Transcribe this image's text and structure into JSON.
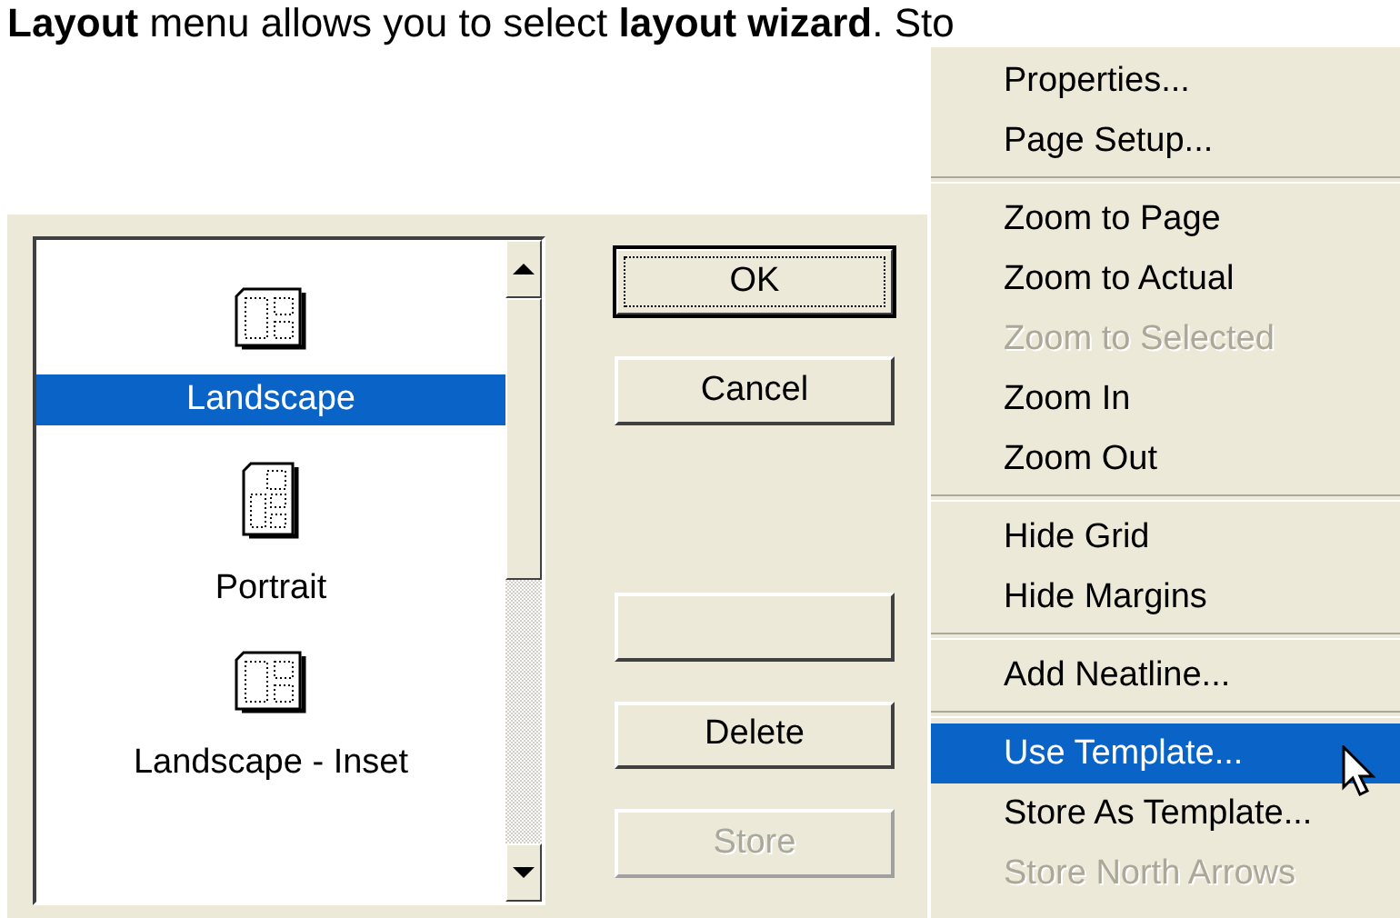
{
  "heading": "**Layout** menu allows you to select **layout wizard**. Sto",
  "layout_list": {
    "items": [
      {
        "label": "Landscape",
        "kind": "landscape",
        "selected": true
      },
      {
        "label": "Portrait",
        "kind": "portrait",
        "selected": false
      },
      {
        "label": "Landscape - Inset",
        "kind": "landscape",
        "selected": false
      }
    ]
  },
  "buttons": [
    {
      "label": "OK",
      "default": true,
      "disabled": false
    },
    {
      "label": "Cancel",
      "default": false,
      "disabled": false
    },
    {
      "default": false,
      "disabled": false
    },
    {
      "label": "Delete",
      "default": false,
      "disabled": false
    },
    {
      "label": "Store",
      "default": false,
      "disabled": true
    }
  ],
  "context_menu": {
    "groups": [
      [
        {
          "label": "Properties...",
          "disabled": false,
          "selected": false
        },
        {
          "label": "Page Setup...",
          "disabled": false,
          "selected": false
        }
      ],
      [
        {
          "label": "Zoom to Page",
          "disabled": false,
          "selected": false
        },
        {
          "label": "Zoom to Actual",
          "disabled": false,
          "selected": false
        },
        {
          "label": "Zoom to Selected",
          "disabled": true,
          "selected": false
        },
        {
          "label": "Zoom In",
          "disabled": false,
          "selected": false
        },
        {
          "label": "Zoom Out",
          "disabled": false,
          "selected": false
        }
      ],
      [
        {
          "label": "Hide Grid",
          "disabled": false,
          "selected": false
        },
        {
          "label": "Hide Margins",
          "disabled": false,
          "selected": false
        }
      ],
      [
        {
          "label": "Add Neatline...",
          "disabled": false,
          "selected": false
        }
      ],
      [
        {
          "label": "Use Template...",
          "disabled": false,
          "selected": true
        },
        {
          "label": "Store As Template...",
          "disabled": false,
          "selected": false
        },
        {
          "label": "Store North Arrows",
          "disabled": true,
          "selected": false
        }
      ]
    ]
  }
}
